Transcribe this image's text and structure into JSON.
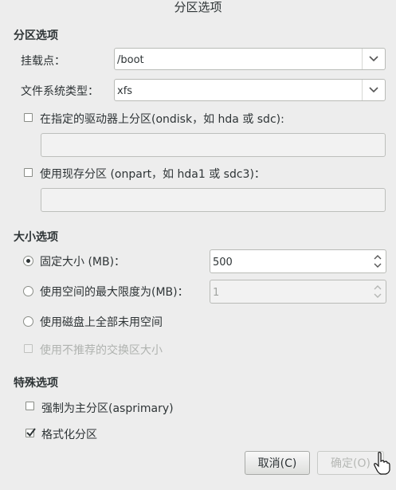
{
  "dialog": {
    "title": "分区选项"
  },
  "partition": {
    "heading": "分区选项",
    "mount_label": "挂载点：",
    "mount_value": "/boot",
    "fs_label": "文件系统类型：",
    "fs_value": "xfs",
    "ondisk_label": "在指定的驱动器上分区(ondisk，如 hda 或 sdc):",
    "ondisk_checked": false,
    "ondisk_value": "",
    "onpart_label": "使用现存分区 (onpart，如 hda1 或 sdc3)：",
    "onpart_checked": false,
    "onpart_value": ""
  },
  "size": {
    "heading": "大小选项",
    "fixed_label": "固定大小 (MB)：",
    "fixed_value": "500",
    "fixed_selected": true,
    "max_label": "使用空间的最大限度为(MB)：",
    "max_value": "1",
    "grow_label": "使用磁盘上全部未用空间",
    "swap_label": "使用不推荐的交换区大小",
    "swap_enabled": false
  },
  "special": {
    "heading": "特殊选项",
    "primary_label": "强制为主分区(asprimary)",
    "primary_checked": false,
    "format_label": "格式化分区",
    "format_checked": true
  },
  "buttons": {
    "cancel": "取消(C)",
    "ok": "确定(O)",
    "ok_enabled": false
  },
  "colors": {
    "background": "#ededed",
    "text": "#2e3436",
    "disabled_text": "#b0b3b0"
  }
}
